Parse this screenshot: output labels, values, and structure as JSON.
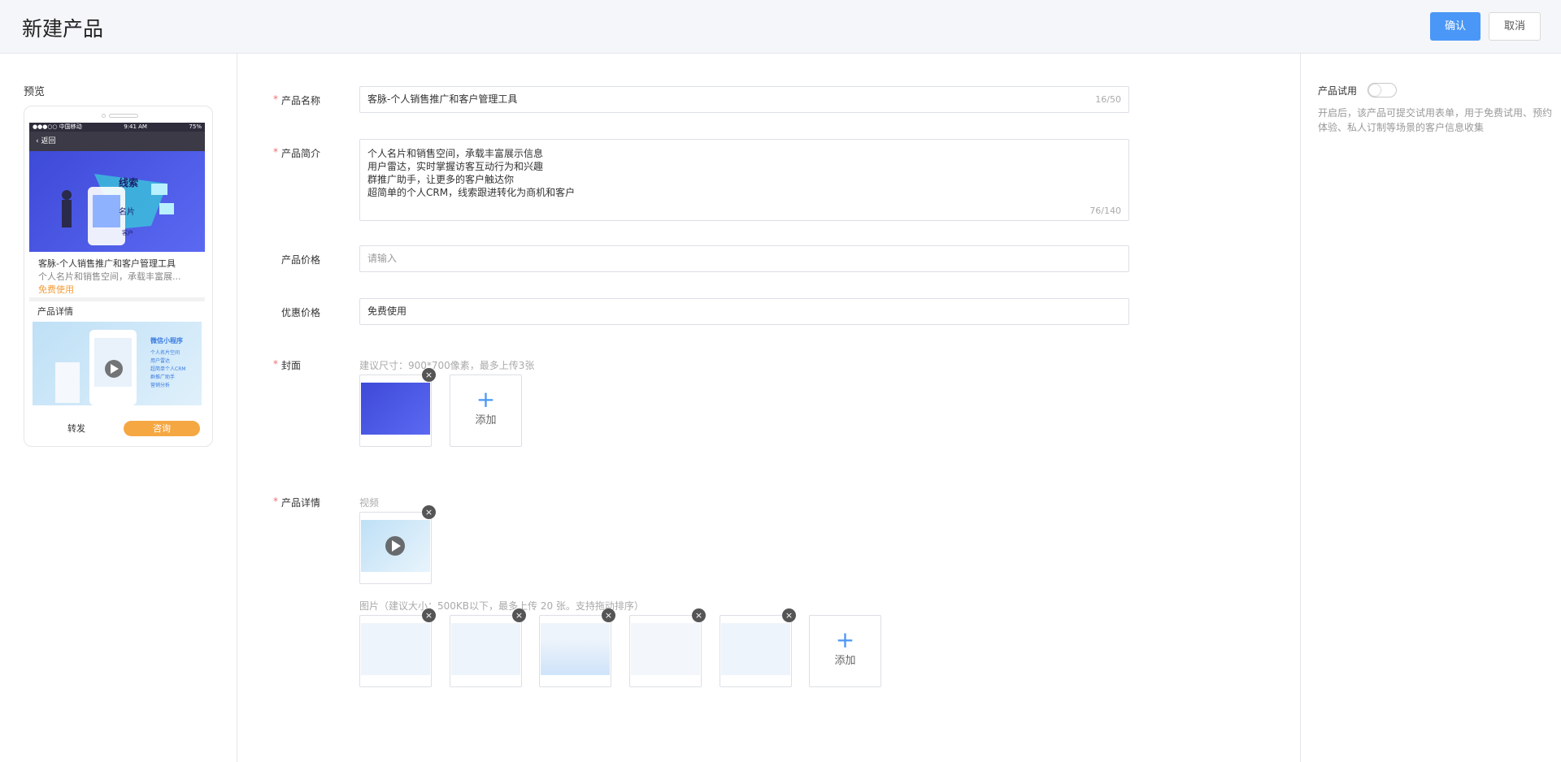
{
  "header": {
    "title": "新建产品",
    "confirm_label": "确认",
    "cancel_label": "取消"
  },
  "preview": {
    "label": "预览",
    "status_left": "●●●○○ 中国移动",
    "status_time": "9:41 AM",
    "status_battery": "75%",
    "back_label": "返回",
    "banner_words": [
      "线索",
      "名片",
      "客户"
    ],
    "product_name": "客脉-个人销售推广和客户管理工具",
    "product_desc": "个人名片和销售空间，承载丰富展...",
    "price_text": "免费使用",
    "detail_title": "产品详情",
    "detail_heading": "微信小程序",
    "detail_lines": [
      "个人名片空间",
      "用户雷达",
      "超简单个人CRM",
      "群推广助手",
      "营销分析"
    ],
    "share_label": "转发",
    "consult_label": "咨询"
  },
  "form": {
    "name_label": "产品名称",
    "name_value": "客脉-个人销售推广和客户管理工具",
    "name_count": "16/50",
    "intro_label": "产品简介",
    "intro_lines": [
      "个人名片和销售空间，承载丰富展示信息",
      "用户雷达，实时掌握访客互动行为和兴趣",
      "群推广助手，让更多的客户触达你",
      "超简单的个人CRM，线索跟进转化为商机和客户"
    ],
    "intro_count": "76/140",
    "price_label": "产品价格",
    "price_placeholder": "请输入",
    "discount_label": "优惠价格",
    "discount_value": "免费使用",
    "cover_label": "封面",
    "cover_hint": "建议尺寸：900*700像素，最多上传3张",
    "add_label": "添加",
    "detail_label": "产品详情",
    "video_label": "视频",
    "images_hint": "图片（建议大小：500KB以下，最多上传 20 张。支持拖动排序）"
  },
  "side": {
    "trial_label": "产品试用",
    "trial_enabled": false,
    "trial_desc": "开启后，该产品可提交试用表单，用于免费试用、预约体验、私人订制等场景的客户信息收集"
  },
  "icons": {
    "close": "close-icon",
    "plus": "plus-icon",
    "play": "play-icon",
    "back": "chevron-left-icon"
  },
  "colors": {
    "primary": "#4a97f7",
    "required": "#f56c6c",
    "price": "#f39c3a",
    "consult": "#f5a742"
  }
}
